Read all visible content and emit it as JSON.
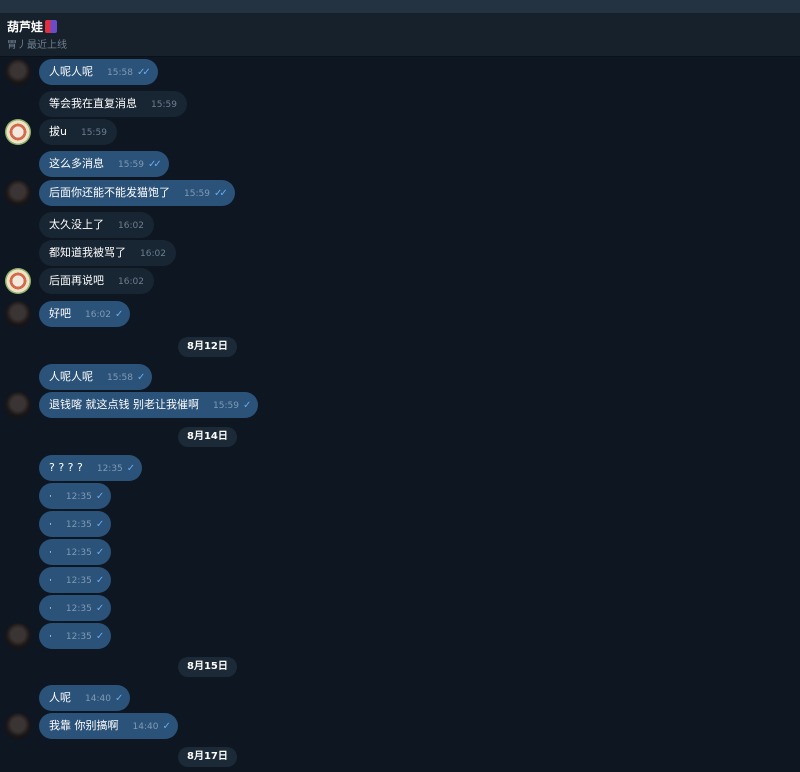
{
  "chat": {
    "name": "葫芦娃",
    "status": "胃丿最近上线"
  },
  "messages": [
    {
      "dir": "out",
      "text": "人呢人呢",
      "time": "15:58",
      "ticks": "✓✓"
    },
    {
      "dir": "in",
      "text": "等会我在直复消息",
      "time": "15:59"
    },
    {
      "dir": "in",
      "text": "拔u",
      "time": "15:59"
    },
    {
      "dir": "out",
      "text": "这么多消息",
      "time": "15:59",
      "ticks": "✓✓"
    },
    {
      "dir": "out",
      "text": "后面你还能不能发猫饱了",
      "time": "15:59",
      "ticks": "✓✓"
    },
    {
      "dir": "in",
      "text": "太久没上了",
      "time": "16:02"
    },
    {
      "dir": "in",
      "text": "都知道我被骂了",
      "time": "16:02"
    },
    {
      "dir": "in",
      "text": "后面再说吧",
      "time": "16:02"
    },
    {
      "dir": "out",
      "text": "好吧",
      "time": "16:02",
      "ticks": "✓"
    },
    {
      "dir": "date",
      "text": "8月12日"
    },
    {
      "dir": "out",
      "text": "人呢人呢",
      "time": "15:58",
      "ticks": "✓"
    },
    {
      "dir": "out",
      "text": "退钱喀 就这点钱 别老让我催啊",
      "time": "15:59",
      "ticks": "✓"
    },
    {
      "dir": "date",
      "text": "8月14日"
    },
    {
      "dir": "out",
      "text": "? ? ? ?",
      "time": "12:35",
      "ticks": "✓"
    },
    {
      "dir": "out",
      "text": "·",
      "time": "12:35",
      "ticks": "✓"
    },
    {
      "dir": "out",
      "text": "·",
      "time": "12:35",
      "ticks": "✓"
    },
    {
      "dir": "out",
      "text": "·",
      "time": "12:35",
      "ticks": "✓"
    },
    {
      "dir": "out",
      "text": "·",
      "time": "12:35",
      "ticks": "✓"
    },
    {
      "dir": "out",
      "text": "·",
      "time": "12:35",
      "ticks": "✓"
    },
    {
      "dir": "out",
      "text": "·",
      "time": "12:35",
      "ticks": "✓"
    },
    {
      "dir": "date",
      "text": "8月15日"
    },
    {
      "dir": "out",
      "text": "人呢",
      "time": "14:40",
      "ticks": "✓"
    },
    {
      "dir": "out",
      "text": "我靠 你别搞啊",
      "time": "14:40",
      "ticks": "✓"
    },
    {
      "dir": "date",
      "text": "8月17日"
    }
  ]
}
